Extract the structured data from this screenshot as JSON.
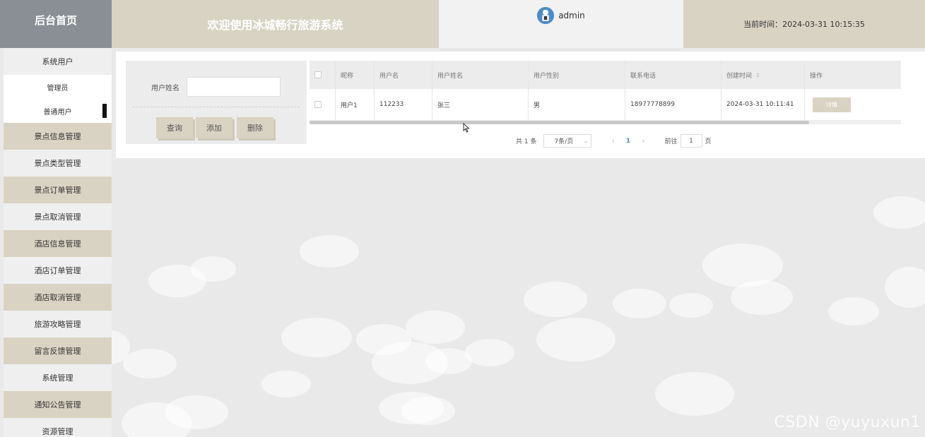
{
  "header": {
    "logo": "后台首页",
    "welcome": "欢迎使用冰城畅行旅游系统",
    "username": "admin",
    "time_label": "当前时间：2024-03-31 10:15:35"
  },
  "sidebar": {
    "groups": [
      {
        "label": "系统用户",
        "sub": [
          "管理员",
          "普通用户"
        ]
      },
      {
        "label": "景点信息管理"
      },
      {
        "label": "景点类型管理"
      },
      {
        "label": "景点订单管理"
      },
      {
        "label": "景点取消管理"
      },
      {
        "label": "酒店信息管理"
      },
      {
        "label": "酒店订单管理"
      },
      {
        "label": "酒店取消管理"
      },
      {
        "label": "旅游攻略管理"
      },
      {
        "label": "留言反馈管理"
      },
      {
        "label": "系统管理"
      },
      {
        "label": "通知公告管理"
      },
      {
        "label": "资源管理"
      }
    ]
  },
  "search": {
    "label": "用户姓名",
    "value": "",
    "buttons": {
      "query": "查询",
      "add": "添加",
      "delete": "删除"
    }
  },
  "table": {
    "headers": [
      "昵称",
      "用户名",
      "用户姓名",
      "用户性别",
      "联系电话",
      "创建时间",
      "操作"
    ],
    "rows": [
      {
        "nickname": "用户1",
        "username": "112233",
        "realname": "张三",
        "gender": "男",
        "phone": "18977778899",
        "created": "2024-03-31 10:11:41",
        "action": "详情"
      }
    ]
  },
  "pager": {
    "total": "共 1 条",
    "page_size": "7条/页",
    "current": "1",
    "goto_label": "前往",
    "goto_value": "1",
    "page_suffix": "页"
  },
  "watermark": "CSDN @yuyuxun1",
  "colors": {
    "tan": "#d9d3c3",
    "logo_bg": "#8a8f95",
    "accent": "#3a8ee6"
  }
}
